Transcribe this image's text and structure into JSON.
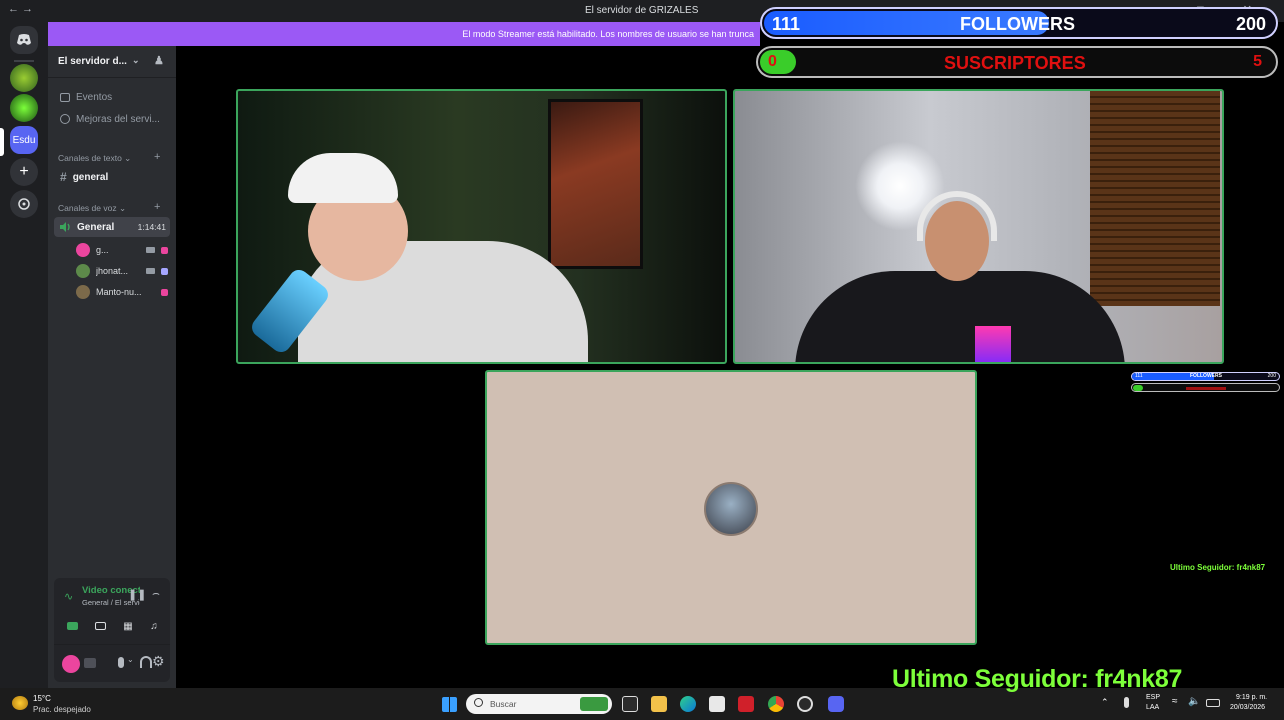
{
  "window": {
    "title": "El servidor de GRIZALES",
    "nav": "← →",
    "controls": "— □ ✕"
  },
  "banner": {
    "text": "El modo Streamer está habilitado. Los nombres de usuario se han trunca"
  },
  "server": {
    "name": "El servidor d...",
    "add_icon": "invite-icon",
    "items": [
      {
        "label": "Eventos",
        "icon": "calendar-icon"
      },
      {
        "label": "Mejoras del servi...",
        "icon": "boost-icon"
      }
    ]
  },
  "server_rail": {
    "active_label": "Esdu"
  },
  "categories": {
    "text": "Canales de texto",
    "voice": "Canales de voz"
  },
  "text_channel": {
    "label": "general"
  },
  "voice_channel": {
    "label": "General",
    "timer": "1:14:41",
    "users": [
      {
        "name": "g...",
        "color": "#eb459e"
      },
      {
        "name": "jhonat...",
        "color": "#5d8a4a"
      },
      {
        "name": "Manto-nu...",
        "color": "#7c6a4a"
      }
    ]
  },
  "voice_panel": {
    "status": "Video conectad",
    "location": "General / El servid..."
  },
  "overlay": {
    "followers_current": "111",
    "followers_label": "FOLLOWERS",
    "followers_goal": "200",
    "subs_current": "0",
    "subs_label": "SUSCRIPTORES",
    "subs_goal": "5",
    "mini_followers_current": "111",
    "mini_followers_label": "FOLLOWERS",
    "mini_followers_goal": "200",
    "last_follower_small": "Ultimo Seguidor: fr4nk87",
    "last_follower": "Ultimo Seguidor: fr4nk87"
  },
  "taskbar": {
    "weather_temp": "15°C",
    "weather_desc": "Prac. despejado",
    "search_placeholder": "Buscar",
    "lang_top": "ESP",
    "lang_bottom": "LAA",
    "time": "9:19 p. m.",
    "date": "20/03/2026"
  },
  "colors": {
    "accent_purple": "#9b59f5",
    "speaking_green": "#3ba55c",
    "overlay_blue": "#1a5cff",
    "overlay_red": "#e01010",
    "overlay_green": "#7dff3a"
  }
}
